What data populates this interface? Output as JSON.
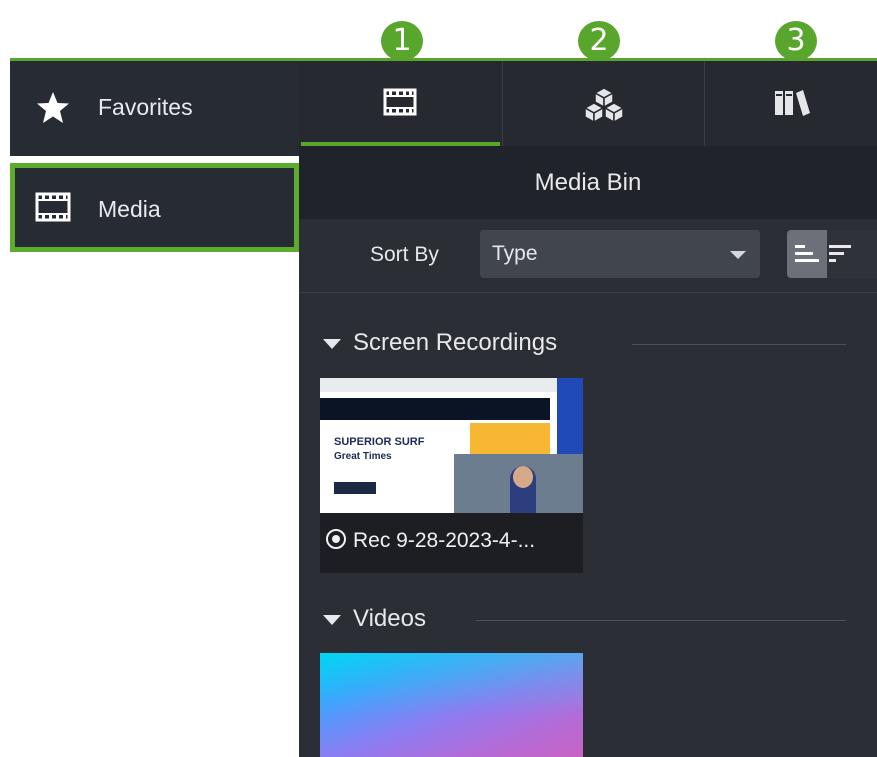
{
  "callouts": [
    "1",
    "2",
    "3"
  ],
  "sidebar": {
    "items": [
      {
        "label": "Favorites",
        "icon": "star-icon"
      },
      {
        "label": "Media",
        "icon": "film-icon",
        "selected": true
      }
    ]
  },
  "tabs": [
    {
      "icon": "film-icon",
      "active": true
    },
    {
      "icon": "cubes-icon"
    },
    {
      "icon": "library-icon"
    }
  ],
  "bin": {
    "title": "Media Bin",
    "sort_label": "Sort By",
    "sort_value": "Type"
  },
  "sections": {
    "recordings": {
      "title": "Screen Recordings",
      "item_name": "Rec 9-28-2023-4-...",
      "thumb_title": "SUPERIOR SURF",
      "thumb_subtitle": "Great Times"
    },
    "videos": {
      "title": "Videos"
    }
  },
  "colors": {
    "accent_green": "#58a62c",
    "panel_bg": "#2b2e35",
    "sidebar_bg": "#272b33"
  }
}
